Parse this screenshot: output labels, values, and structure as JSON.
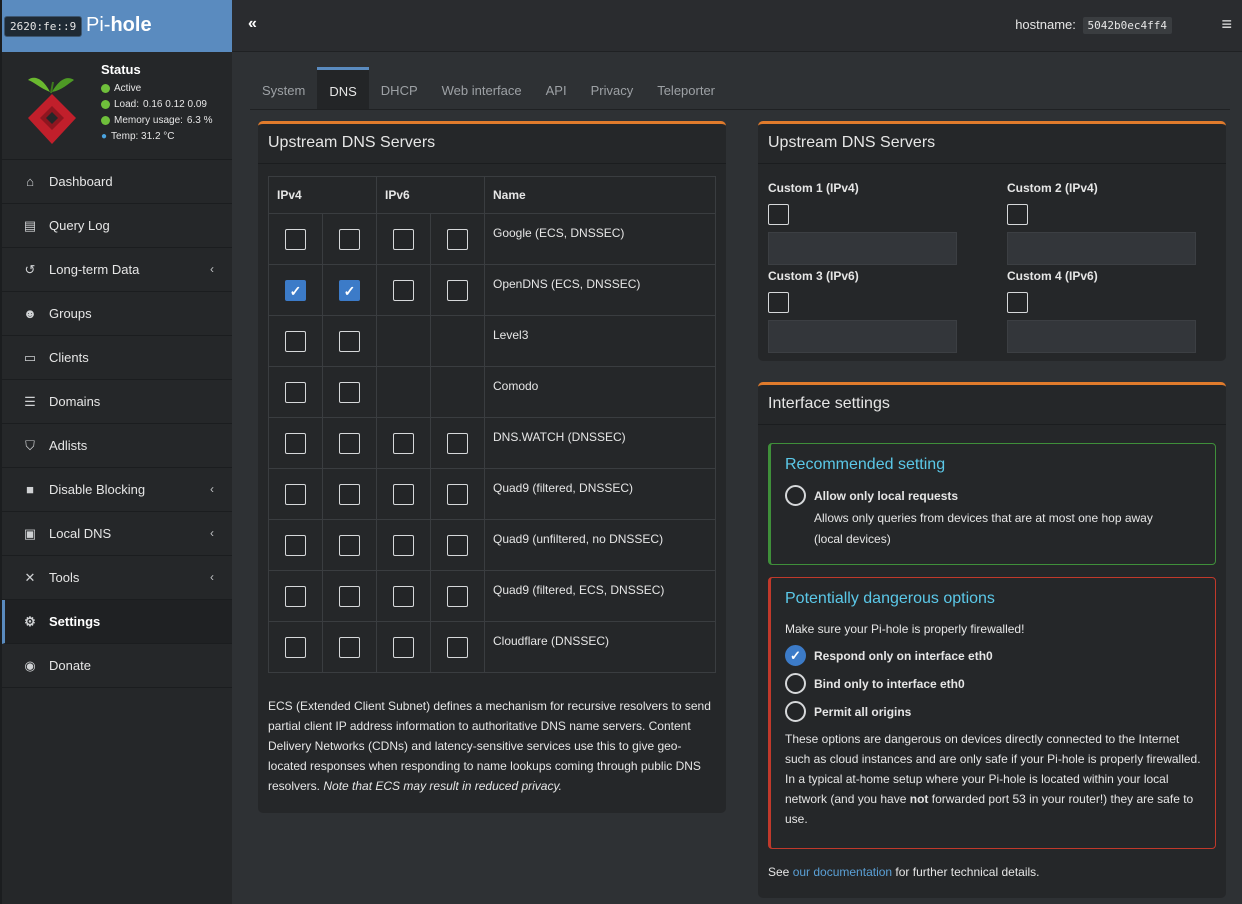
{
  "brand": {
    "ip": "2620:fe::9",
    "name_part1": "Pi-",
    "name_part2": "hole"
  },
  "status": {
    "title": "Status",
    "active": "Active",
    "load_label": "Load:",
    "load_values": "0.16  0.12  0.09",
    "memory_label": "Memory usage:",
    "memory_value": "6.3 %",
    "temp": "Temp: 31.2 °C"
  },
  "nav": {
    "items": [
      {
        "label": "Dashboard",
        "icon": "home-icon"
      },
      {
        "label": "Query Log",
        "icon": "file-icon"
      },
      {
        "label": "Long-term Data",
        "icon": "history-icon"
      },
      {
        "label": "Groups",
        "icon": "users-icon"
      },
      {
        "label": "Clients",
        "icon": "laptop-icon"
      },
      {
        "label": "Domains",
        "icon": "list-icon"
      },
      {
        "label": "Adlists",
        "icon": "shield-icon"
      },
      {
        "label": "Disable Blocking",
        "icon": "stop-icon"
      },
      {
        "label": "Local DNS",
        "icon": "address-book-icon"
      },
      {
        "label": "Tools",
        "icon": "tools-icon"
      },
      {
        "label": "Settings",
        "icon": "gear-icon"
      },
      {
        "label": "Donate",
        "icon": "donate-icon"
      }
    ]
  },
  "topbar": {
    "collapse": "«",
    "hostname_label": "hostname:",
    "hostname_value": "5042b0ec4ff4",
    "menu": "≡"
  },
  "tabs": [
    "System",
    "DNS",
    "DHCP",
    "Web interface",
    "API",
    "Privacy",
    "Teleporter"
  ],
  "upstream": {
    "title": "Upstream DNS Servers",
    "col_ipv4": "IPv4",
    "col_ipv6": "IPv6",
    "col_name": "Name",
    "rows": [
      {
        "name": "Google (ECS, DNSSEC)",
        "v4": [
          false,
          false
        ],
        "v6": [
          false,
          false
        ]
      },
      {
        "name": "OpenDNS (ECS, DNSSEC)",
        "v4": [
          true,
          true
        ],
        "v6": [
          false,
          false
        ]
      },
      {
        "name": "Level3",
        "v4": [
          false,
          false
        ],
        "v6": null
      },
      {
        "name": "Comodo",
        "v4": [
          false,
          false
        ],
        "v6": null
      },
      {
        "name": "DNS.WATCH (DNSSEC)",
        "v4": [
          false,
          false
        ],
        "v6": [
          false,
          false
        ]
      },
      {
        "name": "Quad9 (filtered, DNSSEC)",
        "v4": [
          false,
          false
        ],
        "v6": [
          false,
          false
        ]
      },
      {
        "name": "Quad9 (unfiltered, no DNSSEC)",
        "v4": [
          false,
          false
        ],
        "v6": [
          false,
          false
        ]
      },
      {
        "name": "Quad9 (filtered, ECS, DNSSEC)",
        "v4": [
          false,
          false
        ],
        "v6": [
          false,
          false
        ]
      },
      {
        "name": "Cloudflare (DNSSEC)",
        "v4": [
          false,
          false
        ],
        "v6": [
          false,
          false
        ]
      }
    ],
    "ecs_text": "ECS (Extended Client Subnet) defines a mechanism for recursive resolvers to send partial client IP address information to authoritative DNS name servers. Content Delivery Networks (CDNs) and latency-sensitive services use this to give geo-located responses when responding to name lookups coming through public DNS resolvers.",
    "ecs_note": "Note that ECS may result in reduced privacy."
  },
  "custom": {
    "title": "Upstream DNS Servers",
    "c1": "Custom 1 (IPv4)",
    "c2": "Custom 2 (IPv4)",
    "c3": "Custom 3 (IPv6)",
    "c4": "Custom 4 (IPv6)"
  },
  "interface": {
    "title": "Interface settings",
    "recommended_title": "Recommended setting",
    "local_label": "Allow only local requests",
    "local_desc1": "Allows only queries from devices that are at most one hop away",
    "local_desc2": "(local devices)",
    "danger_title": "Potentially dangerous options",
    "danger_warning": "Make sure your Pi-hole is properly firewalled!",
    "opt_respond": "Respond only on interface eth0",
    "opt_bind": "Bind only to interface eth0",
    "opt_permit": "Permit all origins",
    "danger_desc_a": "These options are dangerous on devices directly connected to the Internet such as cloud instances and are only safe if your Pi-hole is properly firewalled. In a typical at-home setup where your Pi-hole is located within your local network (and you have ",
    "danger_desc_not": "not",
    "danger_desc_b": " forwarded port 53 in your router!) they are safe to use.",
    "doc_see": "See ",
    "doc_link": "our documentation",
    "doc_rest": " for further technical details."
  }
}
